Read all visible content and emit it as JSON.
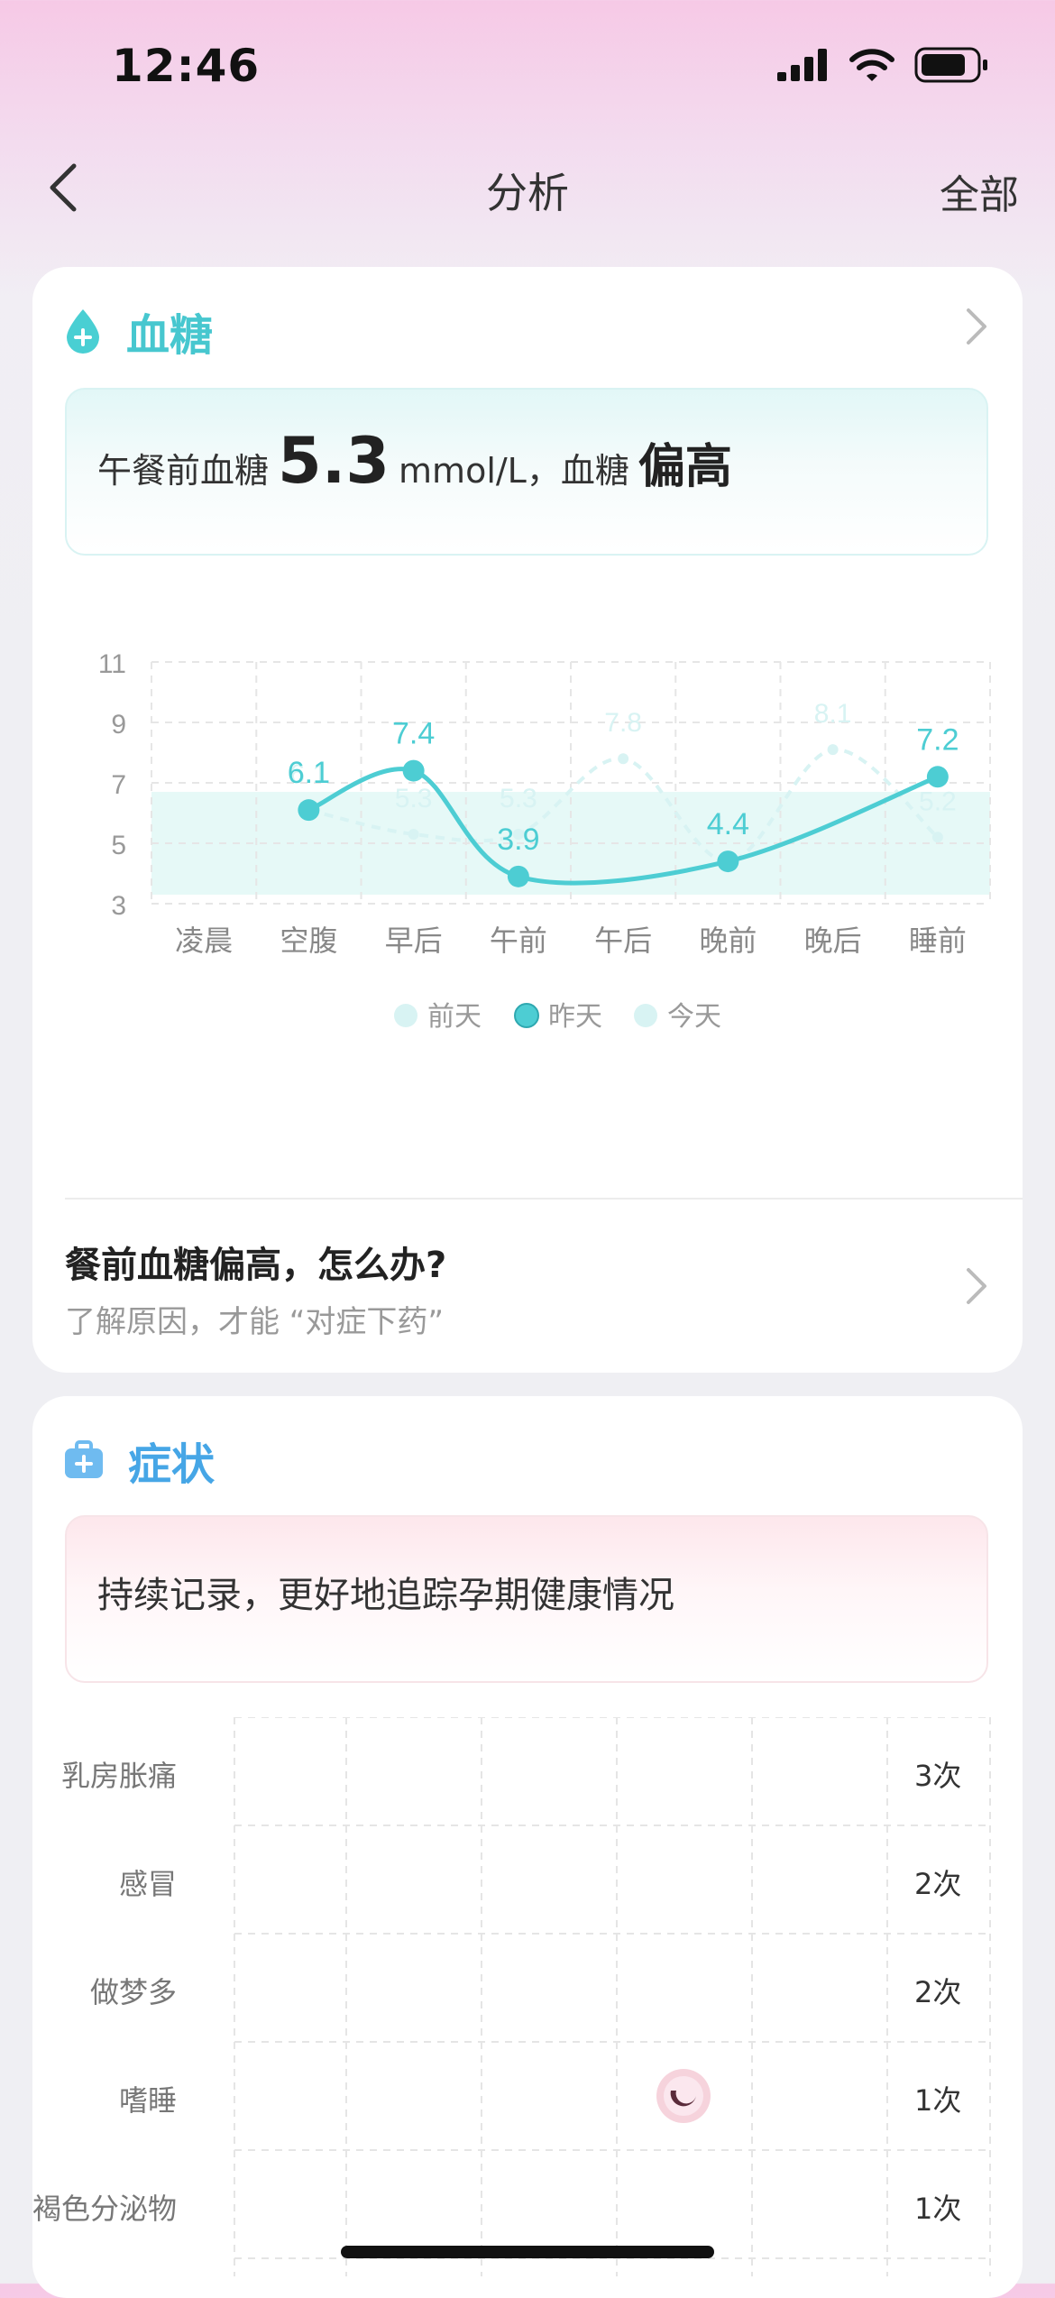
{
  "status": {
    "time": "12:46"
  },
  "nav": {
    "title": "分析",
    "right_label": "全部"
  },
  "glucose": {
    "title": "血糖",
    "summary_prefix": "午餐前血糖",
    "summary_value": "5.3",
    "summary_unit": "mmol/L，血糖",
    "summary_status": "偏高"
  },
  "chart_data": {
    "type": "line",
    "categories": [
      "凌晨",
      "空腹",
      "早后",
      "午前",
      "午后",
      "晚前",
      "晚后",
      "睡前"
    ],
    "ylim": [
      3,
      11
    ],
    "yticks": [
      11,
      9,
      7,
      5,
      3
    ],
    "target_band": [
      3.3,
      6.7
    ],
    "series": [
      {
        "name": "前天",
        "values": [
          null,
          6.1,
          5.3,
          5.3,
          7.8,
          4.4,
          8.1,
          5.2
        ]
      },
      {
        "name": "昨天",
        "values": [
          null,
          6.1,
          7.4,
          3.9,
          null,
          4.4,
          null,
          7.2
        ]
      },
      {
        "name": "今天",
        "values": [
          null,
          null,
          null,
          5.3,
          null,
          null,
          null,
          null
        ]
      }
    ],
    "colors": {
      "yesterday": "#4dcdd3",
      "faded": "#d8f3f3",
      "band": "#e6f9f7",
      "grid": "#e6e6e6"
    }
  },
  "tip": {
    "title": "餐前血糖偏高，怎么办?",
    "subtitle": "了解原因，才能 “对症下药”"
  },
  "symptoms": {
    "title": "症状",
    "banner": "持续记录，更好地追踪孕期健康情况",
    "rows": [
      {
        "label": "乳房胀痛",
        "count": "3次"
      },
      {
        "label": "感冒",
        "count": "2次"
      },
      {
        "label": "做梦多",
        "count": "2次"
      },
      {
        "label": "嗜睡",
        "count": "1次"
      },
      {
        "label": "褐色分泌物",
        "count": "1次"
      }
    ]
  }
}
